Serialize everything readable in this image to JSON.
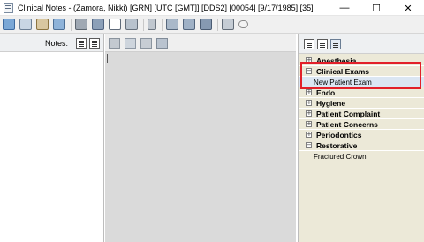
{
  "window": {
    "title": "Clinical Notes - (Zamora, Nikki) [GRN] [UTC  [GMT]] [DDS2] [00054] [9/17/1985] [35]",
    "controls": {
      "minimize": "—",
      "maximize": "☐",
      "close": "✕"
    }
  },
  "toolbar": {
    "icons": [
      "new-note-icon",
      "copy-icon",
      "paste-icon",
      "image-icon",
      "eraser-icon",
      "attach-icon",
      "find-icon",
      "spell-check-icon",
      "pen-icon",
      "template-icon",
      "signature-icon",
      "audio-icon",
      "print-icon",
      "comment-icon"
    ]
  },
  "left_panel": {
    "label": "Notes:"
  },
  "middle_panel": {
    "icons": [
      "edit-icon",
      "copy-icon",
      "paste-icon",
      "stamp-icon"
    ]
  },
  "right_panel": {
    "categories": [
      {
        "label": "Anesthesia",
        "expanded": false,
        "items": []
      },
      {
        "label": "Clinical Exams",
        "expanded": true,
        "items": [
          "New Patient Exam"
        ]
      },
      {
        "label": "Endo",
        "expanded": false,
        "items": []
      },
      {
        "label": "Hygiene",
        "expanded": false,
        "items": []
      },
      {
        "label": "Patient Complaint",
        "expanded": false,
        "items": []
      },
      {
        "label": "Patient Concerns",
        "expanded": false,
        "items": []
      },
      {
        "label": "Periodontics",
        "expanded": false,
        "items": []
      },
      {
        "label": "Restorative",
        "expanded": true,
        "items": [
          "Fractured Crown"
        ]
      }
    ]
  },
  "colors": {
    "highlight": "#e2202a",
    "tree_bg": "#ece9d8",
    "editor_bg": "#dadada"
  }
}
